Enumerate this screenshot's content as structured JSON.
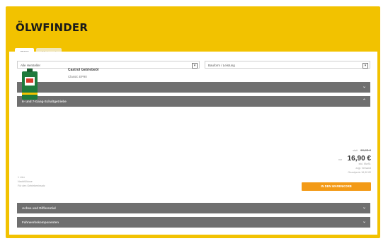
{
  "app": {
    "logo_text": "ÖLWFINDER"
  },
  "tabs": [
    {
      "label": "PKW"
    },
    {
      "label": "Motorrad"
    }
  ],
  "filters": {
    "left_select": {
      "value": "Alle Hersteller"
    },
    "right_select": {
      "value": "Bauform / Leistung"
    }
  },
  "sections": {
    "motor": {
      "label": "Motor"
    },
    "gearbox": {
      "label": "6- und 7-Gang-Schaltgetriebe"
    },
    "axle": {
      "label": "Achse und Differential"
    },
    "fluids": {
      "label": "Fahrwerkskomponenten"
    }
  },
  "product": {
    "name": "Castrol Getriebeöl",
    "subtitle": "Classic EP90",
    "meta": [
      "1 Liter",
      "Nachfülldose",
      "Für den Getriebeeinsatz"
    ],
    "price_label_old": "statt",
    "old_price": "19,90 €",
    "price_label_new": "nur",
    "new_price": "16,90 €",
    "price_notes": [
      "inkl. MwSt.",
      "zzgl. Versand",
      "Grundpreis 16,90 €/l"
    ],
    "cta_label": "IN DEN WARENKORB"
  },
  "colors": {
    "frame": "#f2c200",
    "bar": "#6f6f6f",
    "cta": "#f39a16",
    "can_green": "#1f7a3c"
  }
}
